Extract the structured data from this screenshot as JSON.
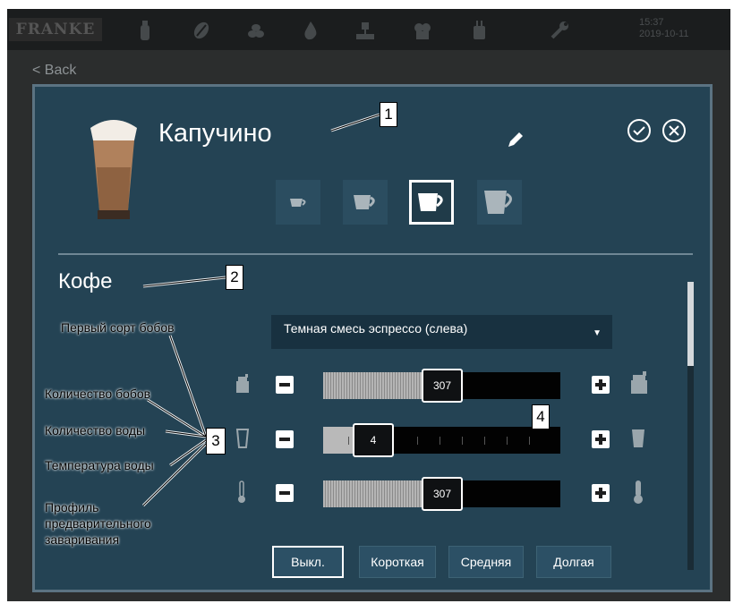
{
  "topbar": {
    "brand": "FRANKE",
    "time": "15:37",
    "date": "2019-10-11",
    "icons": [
      "bottle-icon",
      "coffee-bean-icon",
      "beans-pile-icon",
      "water-drop-icon",
      "brew-unit-icon",
      "milk-icon",
      "cup-icon",
      "wrench-icon"
    ]
  },
  "back_label": "< Back",
  "product": {
    "name": "Капучино",
    "icon": "cappuccino-glass-icon",
    "cup_sizes": [
      "S",
      "M",
      "L",
      "XL"
    ],
    "selected_size": "L"
  },
  "section_title": "Кофе",
  "bean_select": {
    "value": "Темная смесь эспрессо (слева)"
  },
  "sliders": {
    "bean_amount": {
      "display": "307",
      "fill_fraction": 0.5
    },
    "water_amount": {
      "display": "4",
      "fill_fraction": 0.21
    },
    "water_temperature": {
      "display": "307",
      "fill_fraction": 0.5
    }
  },
  "prebrew": {
    "options": [
      "Выкл.",
      "Короткая",
      "Средняя",
      "Долгая"
    ],
    "selected": "Выкл."
  },
  "annotations": {
    "first_bean_type": "Первый сорт бобов",
    "bean_amount": "Количество бобов",
    "water_amount": "Количество воды",
    "water_temperature": "Температура воды",
    "prebrew_profile": "Профиль предварительного заваривания"
  },
  "callouts": [
    "1",
    "2",
    "3",
    "4"
  ],
  "colors": {
    "dialog_bg": "#244354",
    "dialog_border": "#5b7382",
    "dropdown_bg": "#183140",
    "topbar_bg": "#1b1d1e"
  }
}
